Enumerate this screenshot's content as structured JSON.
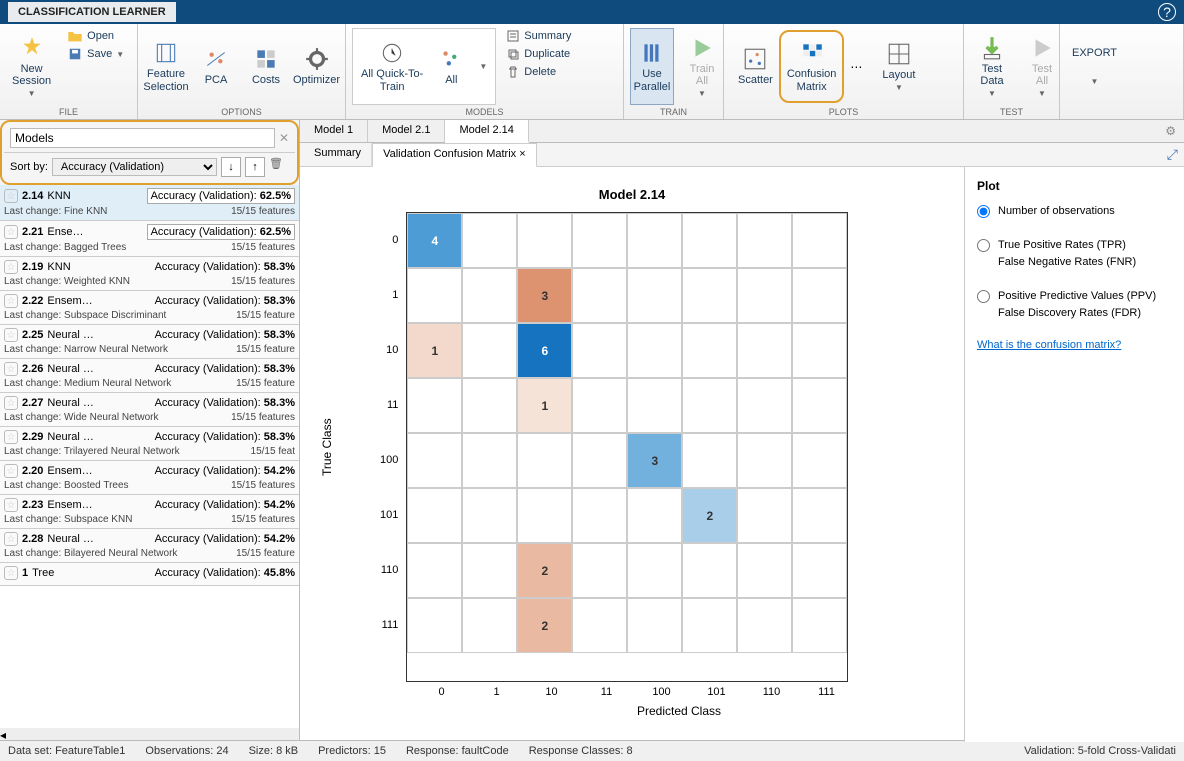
{
  "app": {
    "title": "CLASSIFICATION LEARNER"
  },
  "toolstrip": {
    "file": {
      "label": "FILE",
      "new_session": "New\nSession",
      "open": "Open",
      "save": "Save"
    },
    "options": {
      "label": "OPTIONS",
      "feature_sel": "Feature\nSelection",
      "pca": "PCA",
      "costs": "Costs",
      "optimizer": "Optimizer"
    },
    "models": {
      "label": "MODELS",
      "all_quick": "All Quick-To-\nTrain",
      "all": "All",
      "summary": "Summary",
      "duplicate": "Duplicate",
      "delete": "Delete"
    },
    "train": {
      "label": "TRAIN",
      "use_parallel": "Use\nParallel",
      "train_all": "Train\nAll"
    },
    "plots": {
      "label": "PLOTS",
      "scatter": "Scatter",
      "confusion": "Confusion\nMatrix",
      "layout": "Layout"
    },
    "test": {
      "label": "TEST",
      "test_data": "Test\nData",
      "test_all": "Test\nAll"
    },
    "export": {
      "label": "EXPORT"
    }
  },
  "models_panel": {
    "search_placeholder": "Models",
    "sort_label": "Sort by:",
    "sort_value": "Accuracy (Validation)",
    "list": [
      {
        "id": "2.14",
        "type": "KNN",
        "acc_label": "Accuracy (Validation):",
        "acc": "62.5%",
        "boxed": true,
        "change": "Last change: Fine KNN",
        "feat": "15/15 features",
        "selected": true
      },
      {
        "id": "2.21",
        "type": "Ense…",
        "acc_label": "Accuracy (Validation):",
        "acc": "62.5%",
        "boxed": true,
        "change": "Last change: Bagged Trees",
        "feat": "15/15 features"
      },
      {
        "id": "2.19",
        "type": "KNN",
        "acc_label": "Accuracy (Validation):",
        "acc": "58.3%",
        "change": "Last change: Weighted KNN",
        "feat": "15/15 features"
      },
      {
        "id": "2.22",
        "type": "Ensem…",
        "acc_label": "Accuracy (Validation):",
        "acc": "58.3%",
        "change": "Last change: Subspace Discriminant",
        "feat": "15/15 feature"
      },
      {
        "id": "2.25",
        "type": "Neural …",
        "acc_label": "Accuracy (Validation):",
        "acc": "58.3%",
        "change": "Last change: Narrow Neural Network",
        "feat": "15/15 feature"
      },
      {
        "id": "2.26",
        "type": "Neural …",
        "acc_label": "Accuracy (Validation):",
        "acc": "58.3%",
        "change": "Last change: Medium Neural Network",
        "feat": "15/15 feature"
      },
      {
        "id": "2.27",
        "type": "Neural …",
        "acc_label": "Accuracy (Validation):",
        "acc": "58.3%",
        "change": "Last change: Wide Neural Network",
        "feat": "15/15 features"
      },
      {
        "id": "2.29",
        "type": "Neural …",
        "acc_label": "Accuracy (Validation):",
        "acc": "58.3%",
        "change": "Last change: Trilayered Neural Network",
        "feat": "15/15 feat"
      },
      {
        "id": "2.20",
        "type": "Ensem…",
        "acc_label": "Accuracy (Validation):",
        "acc": "54.2%",
        "change": "Last change: Boosted Trees",
        "feat": "15/15 features"
      },
      {
        "id": "2.23",
        "type": "Ensem…",
        "acc_label": "Accuracy (Validation):",
        "acc": "54.2%",
        "change": "Last change: Subspace KNN",
        "feat": "15/15 features"
      },
      {
        "id": "2.28",
        "type": "Neural …",
        "acc_label": "Accuracy (Validation):",
        "acc": "54.2%",
        "change": "Last change: Bilayered Neural Network",
        "feat": "15/15 feature"
      },
      {
        "id": "1",
        "type": "Tree",
        "acc_label": "Accuracy (Validation):",
        "acc": "45.8%",
        "change": "",
        "feat": ""
      }
    ]
  },
  "doc_tabs": {
    "t1": "Model 1",
    "t2": "Model 2.1",
    "t3": "Model 2.14"
  },
  "sub_tabs": {
    "t1": "Summary",
    "t2": "Validation Confusion Matrix"
  },
  "plot_opts": {
    "title": "Plot",
    "opt1": "Number of observations",
    "opt2a": "True Positive Rates (TPR)",
    "opt2b": "False Negative Rates (FNR)",
    "opt3a": "Positive Predictive Values (PPV)",
    "opt3b": "False Discovery Rates (FDR)",
    "link": "What is the confusion matrix?"
  },
  "status": {
    "dataset": "Data set: FeatureTable1",
    "obs": "Observations: 24",
    "size": "Size: 8 kB",
    "pred": "Predictors: 15",
    "resp": "Response: faultCode",
    "classes": "Response Classes: 8",
    "valid": "Validation: 5-fold Cross-Validati"
  },
  "chart_data": {
    "type": "heatmap",
    "title": "Model 2.14",
    "xlabel": "Predicted Class",
    "ylabel": "True Class",
    "categories": [
      "0",
      "1",
      "10",
      "11",
      "100",
      "101",
      "110",
      "111"
    ],
    "cells": [
      {
        "r": 0,
        "c": 0,
        "v": 4,
        "color": "#4e9cd6"
      },
      {
        "r": 1,
        "c": 2,
        "v": 3,
        "color": "#dd936f"
      },
      {
        "r": 2,
        "c": 0,
        "v": 1,
        "color": "#f2d9cc"
      },
      {
        "r": 2,
        "c": 2,
        "v": 6,
        "color": "#1673bf"
      },
      {
        "r": 3,
        "c": 2,
        "v": 1,
        "color": "#f5e3d8"
      },
      {
        "r": 4,
        "c": 4,
        "v": 3,
        "color": "#72b1de"
      },
      {
        "r": 5,
        "c": 5,
        "v": 2,
        "color": "#a9cee9"
      },
      {
        "r": 6,
        "c": 2,
        "v": 2,
        "color": "#e9b9a1"
      },
      {
        "r": 7,
        "c": 2,
        "v": 2,
        "color": "#e9b9a1"
      }
    ]
  }
}
